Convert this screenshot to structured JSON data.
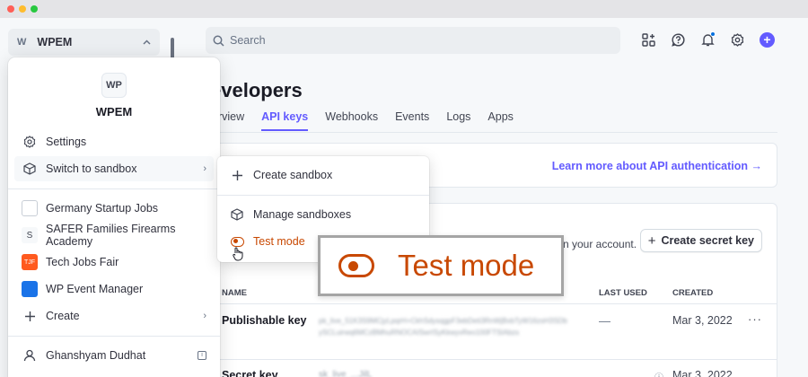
{
  "colors": {
    "accent": "#635bff",
    "test_mode": "#c84801",
    "bg": "#f6f8fa"
  },
  "sidebar": {
    "account_initial": "W",
    "account_name": "WPEM"
  },
  "topbar": {
    "search_placeholder": "Search",
    "icons": [
      "apps-icon",
      "help-icon",
      "notifications-icon",
      "settings-icon",
      "create-icon"
    ]
  },
  "main": {
    "title": "evelopers",
    "tabs": [
      "erview",
      "API keys",
      "Webhooks",
      "Events",
      "Logs",
      "Apps"
    ],
    "active_tab": "API keys",
    "learn_link": "Learn more about API authentication →",
    "account_text": "n your account.",
    "create_secret_key": "Create secret key",
    "table": {
      "headers": {
        "name": "NAME",
        "last_used": "LAST USED",
        "created": "CREATED"
      },
      "rows": [
        {
          "name": "Publishable key",
          "token": "pk_live_51K3S9MCjyLpqrH+CkhSdysqgpF3ebDeti3RnWjBxbTyW16zsH3SDbySCLuirwq6MCzBMhuRNOCAISwrISyKkwyvReo100FTSIAbzs",
          "last_used": "—",
          "created": "Mar 3, 2022",
          "more": "···"
        },
        {
          "name": "Secret key",
          "token": "sk_live_...JilL",
          "created": "Mar 3, 2022"
        }
      ]
    }
  },
  "account_menu": {
    "logo": "WP",
    "name": "WPEM",
    "items": [
      {
        "label": "Settings",
        "icon": "gear-icon"
      },
      {
        "label": "Switch to sandbox",
        "icon": "sandbox-cube-icon"
      }
    ],
    "accounts": [
      {
        "label": "Germany Startup Jobs",
        "avatar": ""
      },
      {
        "label": "SAFER Families Firearms Academy",
        "avatar": "S"
      },
      {
        "label": "Tech Jobs Fair",
        "avatar": "TJF"
      },
      {
        "label": "WP Event Manager",
        "avatar": ""
      }
    ],
    "create_label": "Create",
    "user_name": "Ghanshyam Dudhat"
  },
  "sandbox_submenu": {
    "create": "Create sandbox",
    "manage": "Manage sandboxes",
    "test_mode": "Test mode"
  },
  "zoom_callout": {
    "label": "Test mode"
  }
}
